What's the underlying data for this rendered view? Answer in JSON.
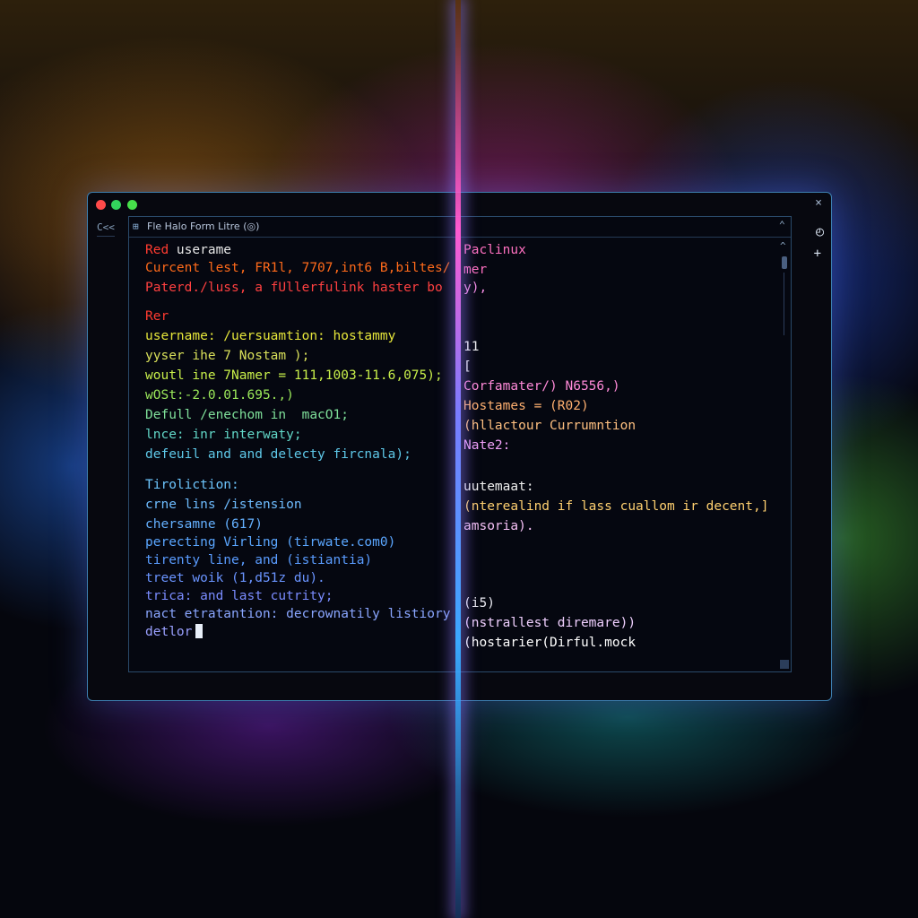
{
  "window": {
    "left_control": "C<<",
    "close_glyph": "×",
    "terminal_icon": "⊞",
    "terminal_title": "Fle Halo Form Litre  (◎)",
    "chevron": "⌃",
    "timer_icon": "timer-icon",
    "plus": "+"
  },
  "terminal_left": {
    "lines": [
      {
        "text": "Red",
        "color": "#ff3b30",
        "extra": " userame",
        "extra_color": "#e8e8e8"
      },
      {
        "text": "Curcent lest, FR1l, 7707,int6 B,biltes/",
        "color": "#ff6a1a"
      },
      {
        "text": "Paterd./luss, a fUllerfulink haster bo",
        "color": "#ff4040"
      },
      {
        "text": "Rer",
        "color": "#ff3b30"
      },
      {
        "text": "username: /uersuamtion: hostammy",
        "color": "#e6e63a"
      },
      {
        "text": "yyser ihe 7 Nostam );",
        "color": "#d9e05a"
      },
      {
        "text": "woutl ine 7Namer = 111,1003-11.6,075);",
        "color": "#c8ef4a"
      },
      {
        "text": "wOSt:-2.0.01.695.,)",
        "color": "#9be85a"
      },
      {
        "text": "Defull /enechom in  macO1;",
        "color": "#7fe09a"
      },
      {
        "text": "lnce: inr interwaty;",
        "color": "#62d8c8"
      },
      {
        "text": "defeuil and and delecty fircnala);",
        "color": "#5ec8e8"
      },
      {
        "text": "Tiroliction:",
        "color": "#6ec7ff"
      },
      {
        "text": "crne lins /istension",
        "color": "#6ebcff"
      },
      {
        "text": "chersamne (617)",
        "color": "#64b0ff"
      },
      {
        "text": "perecting Virling (tirwate.com0)",
        "color": "#5aa6ff"
      },
      {
        "text": "tirenty line, and (istiantia)",
        "color": "#5a9cff"
      },
      {
        "text": "treet woik (1,d51z du).",
        "color": "#6a94ff"
      },
      {
        "text": "trica: and last cutrity;",
        "color": "#7a8cff"
      },
      {
        "text": "nact etratantion: decrownatily listiory",
        "color": "#8aa6ff"
      },
      {
        "text": "detlor",
        "color": "#9aa0ff"
      }
    ]
  },
  "terminal_right": {
    "lines": [
      {
        "text": "Paclinux",
        "color": "#ff70c0"
      },
      {
        "text": "mer",
        "color": "#ff70c0"
      },
      {
        "text": "y),",
        "color": "#f08ae0"
      },
      {
        "text": "11",
        "color": "#f0f0f0"
      },
      {
        "text": "[",
        "color": "#f0f0f0"
      },
      {
        "text": "Corfamater/) N6556,)",
        "color": "#ff8ad8"
      },
      {
        "text": "Hostames = (R02)",
        "color": "#ffb070"
      },
      {
        "text": "(hllactour Currumntion",
        "color": "#ffc080"
      },
      {
        "text": "Nate2:",
        "color": "#f0a0f8"
      },
      {
        "text": "uutemaat:",
        "color": "#f0f0f0"
      },
      {
        "text": "(nterealind if lass cuallom ir decent,]",
        "color": "#ffd070"
      },
      {
        "text": "amsoria).",
        "color": "#f5c0f5"
      },
      {
        "text": "(i5)",
        "color": "#e8e8f0"
      },
      {
        "text": "(nstrallest diremare))",
        "color": "#f0d0ff"
      },
      {
        "text": "(hostarier(Dirful.mock",
        "color": "#ffffff"
      }
    ]
  },
  "colors": {
    "window_border": "#3d7fb0",
    "beam": "#7a7cff"
  }
}
